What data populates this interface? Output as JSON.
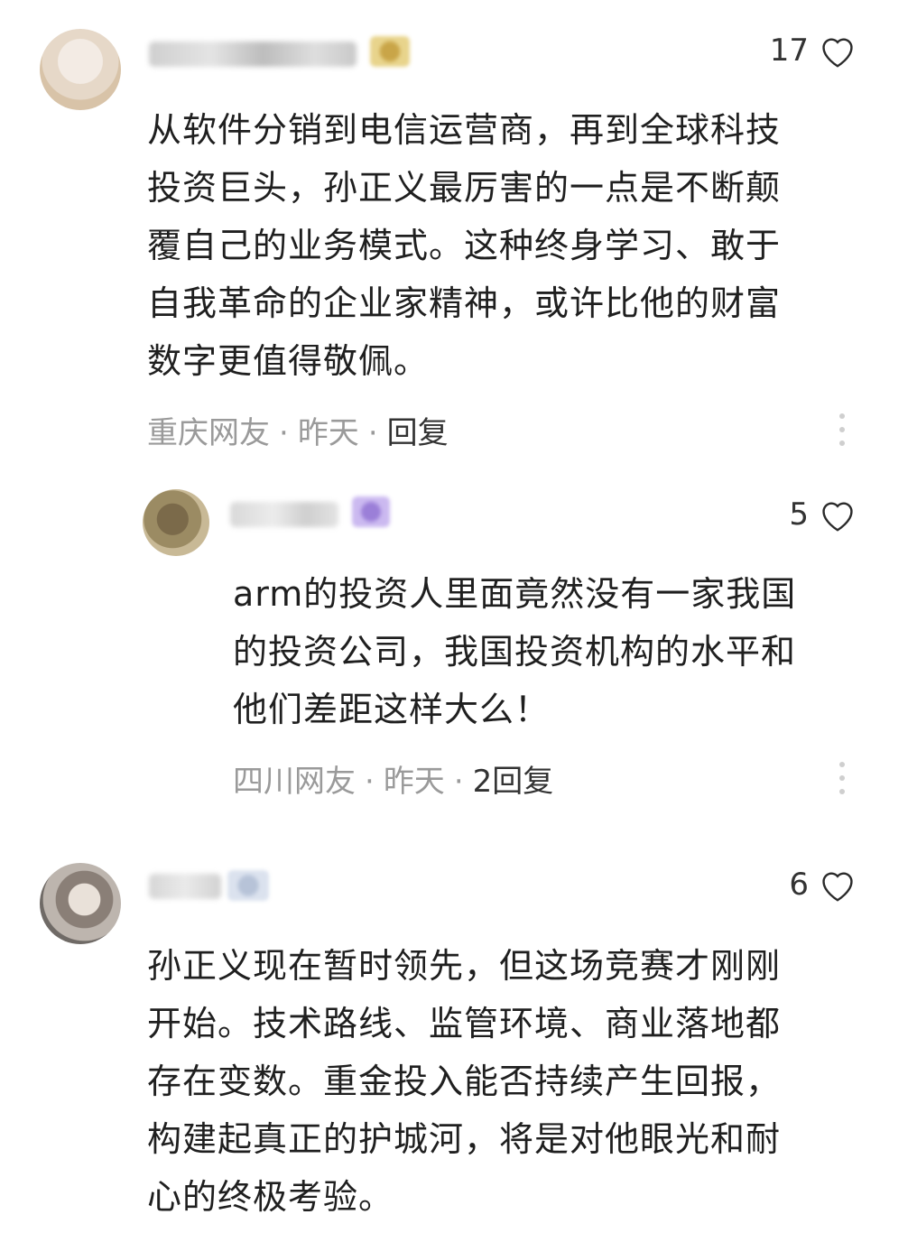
{
  "comments": [
    {
      "likes": "17",
      "text": "从软件分销到电信运营商，再到全球科技投资巨头，孙正义最厉害的一点是不断颠覆自己的业务模式。这种终身学习、敢于自我革命的企业家精神，或许比他的财富数字更值得敬佩。",
      "location": "重庆网友",
      "time": "昨天",
      "reply_label": "回复"
    },
    {
      "likes": "5",
      "text": "arm的投资人里面竟然没有一家我国的投资公司，我国投资机构的水平和他们差距这样大么！",
      "location": "四川网友",
      "time": "昨天",
      "reply_label": "2回复"
    },
    {
      "likes": "6",
      "text": "孙正义现在暂时领先，但这场竞赛才刚刚开始。技术路线、监管环境、商业落地都存在变数。重金投入能否持续产生回报，构建起真正的护城河，将是对他眼光和耐心的终极考验。"
    }
  ],
  "separator": "·",
  "icons": {
    "like": "heart-outline-icon",
    "more": "vertical-ellipsis-icon"
  },
  "colors": {
    "meta_text": "#9a9a9a",
    "body_text": "#1f1f1f",
    "reply_text": "#333333"
  }
}
